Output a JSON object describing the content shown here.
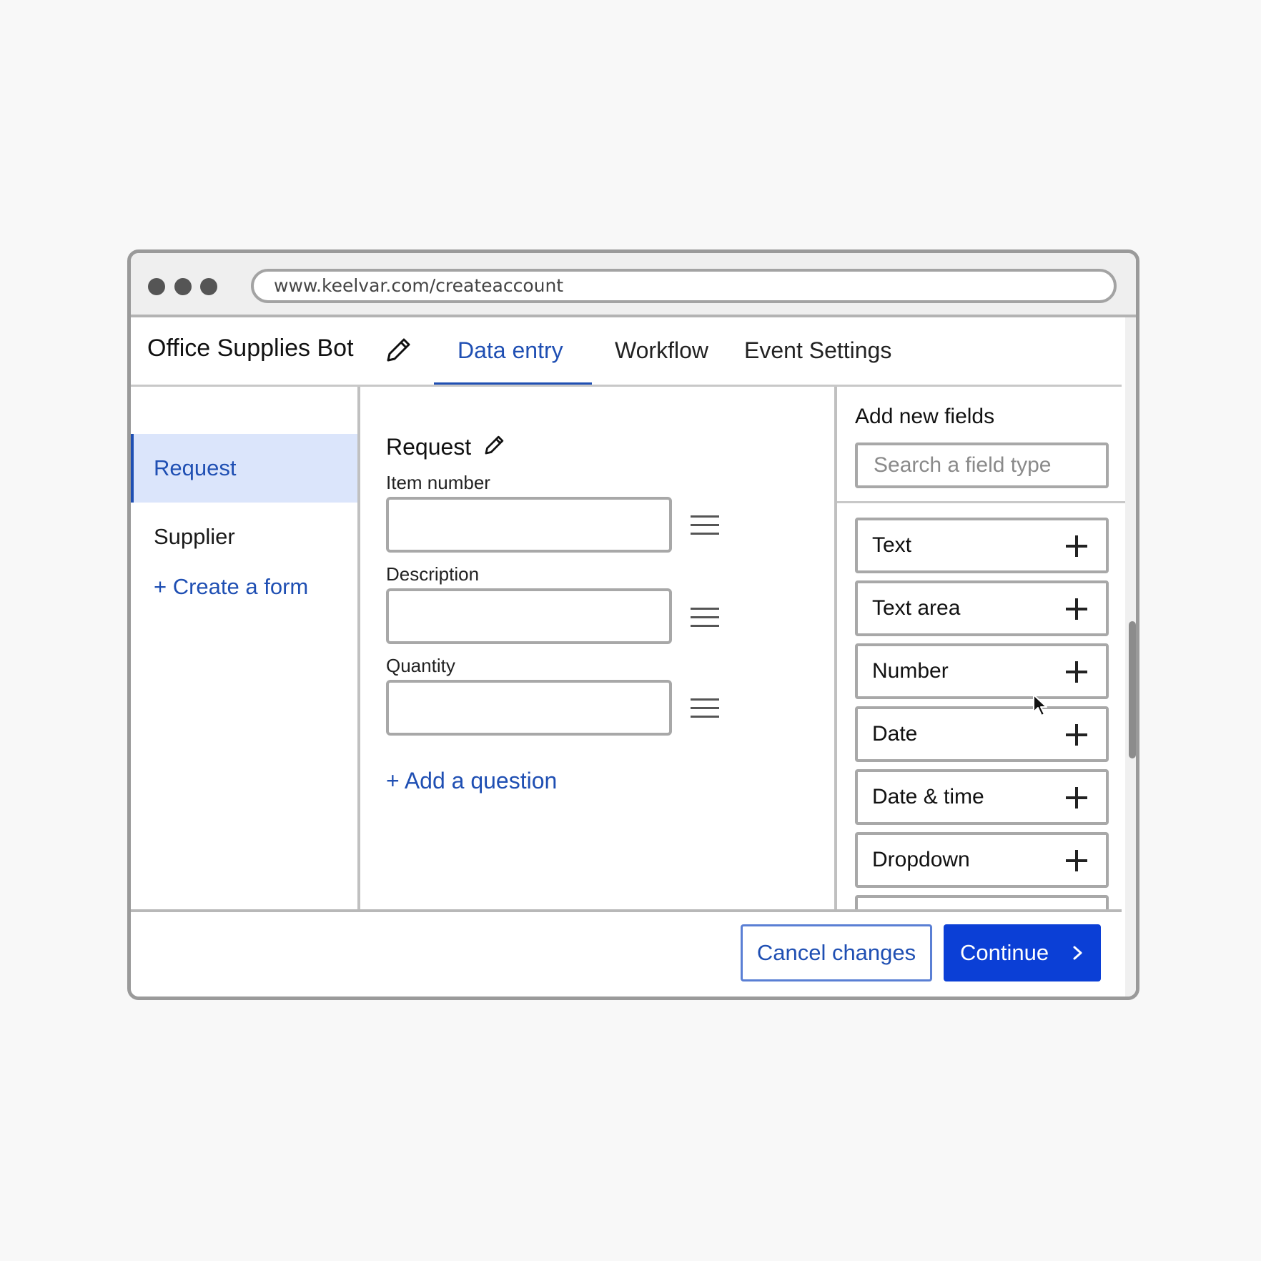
{
  "browser": {
    "url": "www.keelvar.com/createaccount"
  },
  "header": {
    "title": "Office Supplies Bot",
    "tabs": [
      {
        "label": "Data entry",
        "active": true
      },
      {
        "label": "Workflow",
        "active": false
      },
      {
        "label": "Event Settings",
        "active": false
      }
    ]
  },
  "sidebar": {
    "items": [
      {
        "label": "Request",
        "active": true
      },
      {
        "label": "Supplier",
        "active": false
      }
    ],
    "create_link": "+ Create a form"
  },
  "form": {
    "title": "Request",
    "fields": [
      {
        "label": "Item number",
        "value": ""
      },
      {
        "label": "Description",
        "value": ""
      },
      {
        "label": "Quantity",
        "value": ""
      }
    ],
    "add_question": "+ Add a question"
  },
  "field_panel": {
    "title": "Add new fields",
    "search_placeholder": "Search a field type",
    "types": [
      "Text",
      "Text area",
      "Number",
      "Date",
      "Date & time",
      "Dropdown"
    ]
  },
  "footer": {
    "cancel_label": "Cancel changes",
    "continue_label": "Continue"
  },
  "colors": {
    "accent": "#1f4fb3",
    "primary_button": "#0b3fd6",
    "active_row": "#dbe5fb"
  },
  "icons": [
    "pencil-icon",
    "drag-handle-icon",
    "plus-icon",
    "chevron-right-icon",
    "mouse-cursor-icon"
  ]
}
